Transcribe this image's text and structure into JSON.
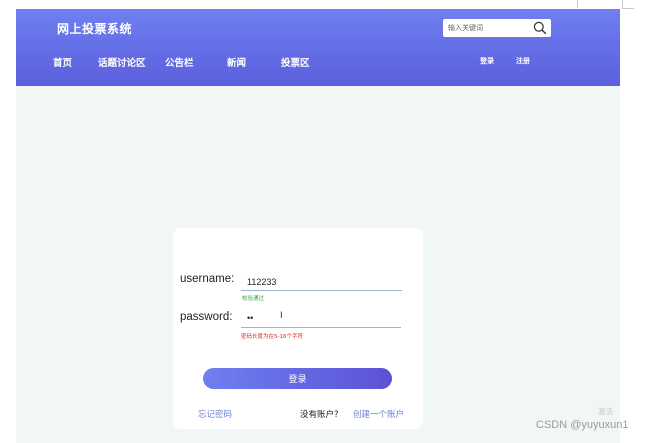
{
  "header": {
    "brand": "网上投票系统",
    "nav": [
      "首页",
      "话题讨论区",
      "公告栏",
      "新闻",
      "投票区"
    ],
    "search_placeholder": "输入关键词",
    "login_link": "登录",
    "register_link": "注册"
  },
  "form": {
    "username_label": "username:",
    "username_value": "112233",
    "username_hint": "校验通过",
    "password_label": "password:",
    "password_value": "••",
    "password_hint": "密码长度为在5-16个字符",
    "submit_label": "登录",
    "forgot_label": "忘记密码",
    "no_account_text": "没有账户?",
    "create_account_label": "创建一个账户"
  },
  "overlay": {
    "text_cursor": "I",
    "activate_text": "激活",
    "csdn_text": "CSDN @yuyuxun1"
  },
  "colors": {
    "nav_gradient_top": "#6f7ff0",
    "nav_gradient_bottom": "#5b5fdc",
    "page_bg": "#f1f7f7",
    "link": "#6b82d8",
    "hint_ok": "#3aa23a",
    "hint_error": "#d22a2a"
  }
}
